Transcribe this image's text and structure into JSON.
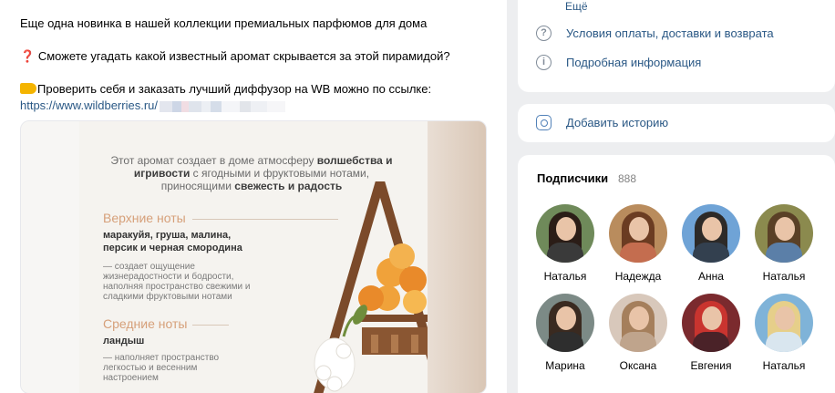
{
  "post": {
    "line1": "Еще одна новинка в нашей коллекции премиальных парфюмов для дома",
    "line2_emoji": "❓",
    "line2": "Сможете угадать какой известный аромат скрывается за этой пирамидой?",
    "line3": "Проверить себя и заказать лучший диффузор на WB можно по ссылке:",
    "link": "https://www.wildberries.ru/",
    "image": {
      "intro_plain1": "Этот аромат создает в доме атмосферу ",
      "intro_bold1": "волшебства и игривости",
      "intro_plain2": " с ягодными и фруктовыми нотами, приносящими ",
      "intro_bold2": "свежесть и радость",
      "top_notes_title": "Верхние ноты",
      "top_notes_list": "маракуйя, груша, малина, персик и черная смородина",
      "top_notes_desc": "— создает ощущение жизнерадостности и бодрости, наполняя пространство свежими и сладкими фруктовыми нотами",
      "mid_notes_title": "Средние ноты",
      "mid_notes_list": "ландыш",
      "mid_notes_desc": "— наполняет пространство легкостью и весенним настроением"
    }
  },
  "sidebar": {
    "more_label": "Ещё",
    "payment_label": "Условия оплаты, доставки и возврата",
    "info_label": "Подробная информация",
    "story_label": "Добавить историю",
    "info_icon_glyph": "i",
    "payment_icon_glyph": "?"
  },
  "subscribers": {
    "title": "Подписчики",
    "count": "888",
    "people": [
      {
        "name": "Наталья",
        "bg": "#6f8a5a",
        "hair": "#2b1d17",
        "body": "#3a3a3a"
      },
      {
        "name": "Надежда",
        "bg": "#b98c5d",
        "hair": "#6b3c22",
        "body": "#c46d4f"
      },
      {
        "name": "Анна",
        "bg": "#6fa3d6",
        "hair": "#2d2a28",
        "body": "#33404f"
      },
      {
        "name": "Наталья",
        "bg": "#8b8a4e",
        "hair": "#5a4026",
        "body": "#5b7fa8"
      },
      {
        "name": "Марина",
        "bg": "#7c8a86",
        "hair": "#3a2a20",
        "body": "#2e2e2e"
      },
      {
        "name": "Оксана",
        "bg": "#d8c8bb",
        "hair": "#a57f5c",
        "body": "#bfa48c"
      },
      {
        "name": "Евгения",
        "bg": "#7b2a2e",
        "hair": "#c9342f",
        "body": "#4a2228"
      },
      {
        "name": "Наталья",
        "bg": "#7fb3d8",
        "hair": "#e6cf8a",
        "body": "#d9e6ef"
      }
    ]
  },
  "colors": {
    "link": "#2a5885",
    "accent_notes": "#d6a07a"
  }
}
